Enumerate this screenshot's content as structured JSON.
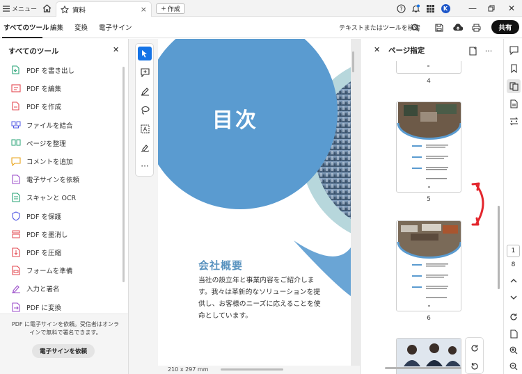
{
  "titlebar": {
    "menu_label": "メニュー",
    "tab_title": "資料",
    "new_label": "作成",
    "avatar_initial": "K"
  },
  "toolbar": {
    "tabs": [
      "すべてのツール",
      "編集",
      "変換",
      "電子サイン"
    ],
    "active_tab": "すべてのツール",
    "search_label": "テキストまたはツールを検索",
    "share_label": "共有"
  },
  "left_panel": {
    "title": "すべてのツール",
    "tools": [
      {
        "label": "PDF を書き出し",
        "icon": "export-pdf-icon",
        "color": "#27a376"
      },
      {
        "label": "PDF を編集",
        "icon": "edit-pdf-icon",
        "color": "#e34850"
      },
      {
        "label": "PDF を作成",
        "icon": "create-pdf-icon",
        "color": "#e34850"
      },
      {
        "label": "ファイルを結合",
        "icon": "combine-files-icon",
        "color": "#5258e4"
      },
      {
        "label": "ページを整理",
        "icon": "organize-pages-icon",
        "color": "#27a376"
      },
      {
        "label": "コメントを追加",
        "icon": "comment-icon",
        "color": "#e8a317"
      },
      {
        "label": "電子サインを依頼",
        "icon": "request-esign-icon",
        "color": "#9b4dca"
      },
      {
        "label": "スキャンと OCR",
        "icon": "scan-ocr-icon",
        "color": "#27a376"
      },
      {
        "label": "PDF を保護",
        "icon": "protect-pdf-icon",
        "color": "#5258e4"
      },
      {
        "label": "PDF を墨消し",
        "icon": "redact-pdf-icon",
        "color": "#e34850"
      },
      {
        "label": "PDF を圧縮",
        "icon": "compress-pdf-icon",
        "color": "#e34850"
      },
      {
        "label": "フォームを準備",
        "icon": "prepare-form-icon",
        "color": "#e34850"
      },
      {
        "label": "入力と署名",
        "icon": "fill-sign-icon",
        "color": "#9b4dca"
      },
      {
        "label": "PDF に変換",
        "icon": "convert-pdf-icon",
        "color": "#9b4dca"
      }
    ],
    "footer_text": "PDF に電子サインを依頼。受信者はオンラインで無料で署名できます。",
    "footer_button": "電子サインを依頼"
  },
  "document": {
    "title": "目次",
    "heading": "会社概要",
    "body": "当社の設立年と事業内容をご紹介します。我々は革新的なソリューションを提供し、お客様のニーズに応えることを使命としています。",
    "page_size": "210 x 297 mm",
    "primary_color": "#5a9bd0",
    "light_color": "#b7d7dc"
  },
  "pages_panel": {
    "title": "ページ指定",
    "page_numbers": [
      "4",
      "5",
      "6"
    ],
    "arrow_color": "#e3262d"
  },
  "right_rail": {
    "current_page": "1",
    "total_pages": "8"
  }
}
